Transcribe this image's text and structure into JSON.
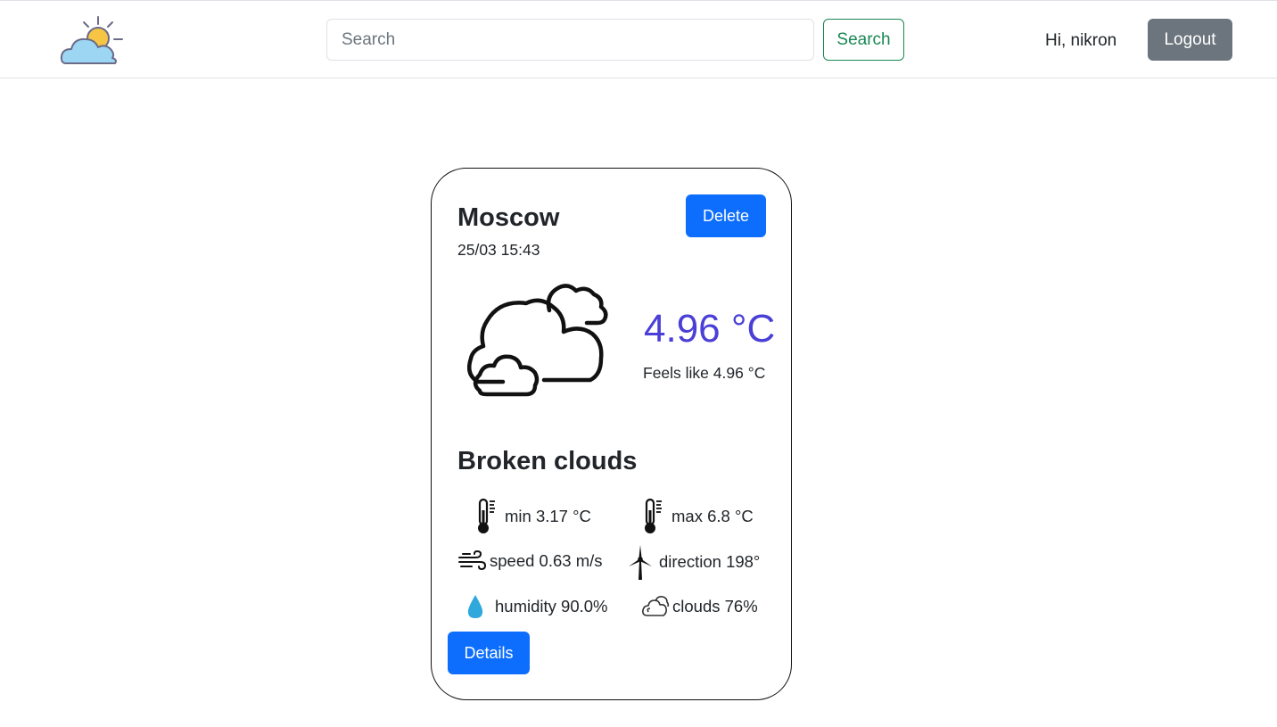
{
  "header": {
    "logo_icon": "partly-cloudy-sun-icon",
    "search": {
      "placeholder": "Search",
      "value": ""
    },
    "search_button_label": "Search",
    "greeting": "Hi, nikron",
    "logout_label": "Logout"
  },
  "card": {
    "city": "Moscow",
    "date": "25/03 15:43",
    "delete_label": "Delete",
    "weather_icon": "broken-clouds-icon",
    "temperature": "4.96 °C",
    "feels_like": "Feels like 4.96 °C",
    "description": "Broken clouds",
    "stats": {
      "min": {
        "icon": "thermometer-icon",
        "text": "min 3.17 °C"
      },
      "max": {
        "icon": "thermometer-icon",
        "text": "max 6.8 °C"
      },
      "speed": {
        "icon": "wind-icon",
        "text": "speed 0.63 m/s"
      },
      "direction": {
        "icon": "wind-turbine-icon",
        "text": "direction 198°"
      },
      "humidity": {
        "icon": "water-drop-icon",
        "text": "humidity 90.0%"
      },
      "clouds": {
        "icon": "cloud-outline-icon",
        "text": "clouds 76%"
      }
    },
    "details_label": "Details"
  },
  "colors": {
    "primary": "#0d6efd",
    "success": "#198754",
    "secondary": "#6c757d",
    "temperature": "#4a3fd7",
    "drop": "#2fa8dc"
  }
}
